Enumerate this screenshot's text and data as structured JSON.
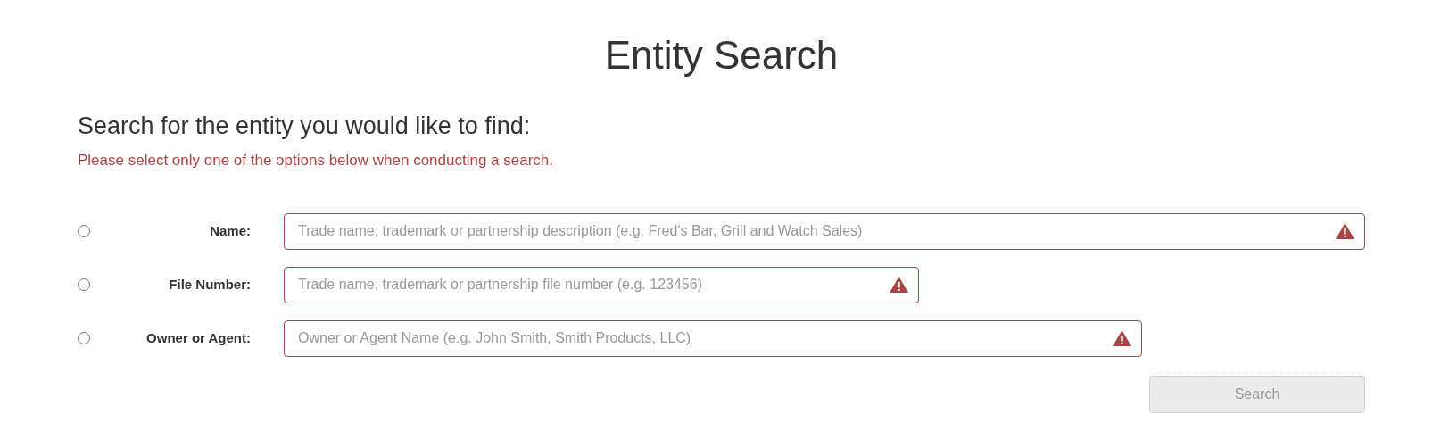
{
  "title": "Entity Search",
  "heading": "Search for the entity you would like to find:",
  "notice": "Please select only one of the options below when conducting a search.",
  "options": [
    {
      "label": "Name:",
      "placeholder": "Trade name, trademark or partnership description (e.g. Fred's Bar, Grill and Watch Sales)",
      "selected": false,
      "invalid": true
    },
    {
      "label": "File Number:",
      "placeholder": "Trade name, trademark or partnership file number (e.g. 123456)",
      "selected": false,
      "invalid": true
    },
    {
      "label": "Owner or Agent:",
      "placeholder": "Owner or Agent Name (e.g. John Smith, Smith Products, LLC)",
      "selected": false,
      "invalid": true
    }
  ],
  "search_button": {
    "label": "Search",
    "disabled": true
  }
}
